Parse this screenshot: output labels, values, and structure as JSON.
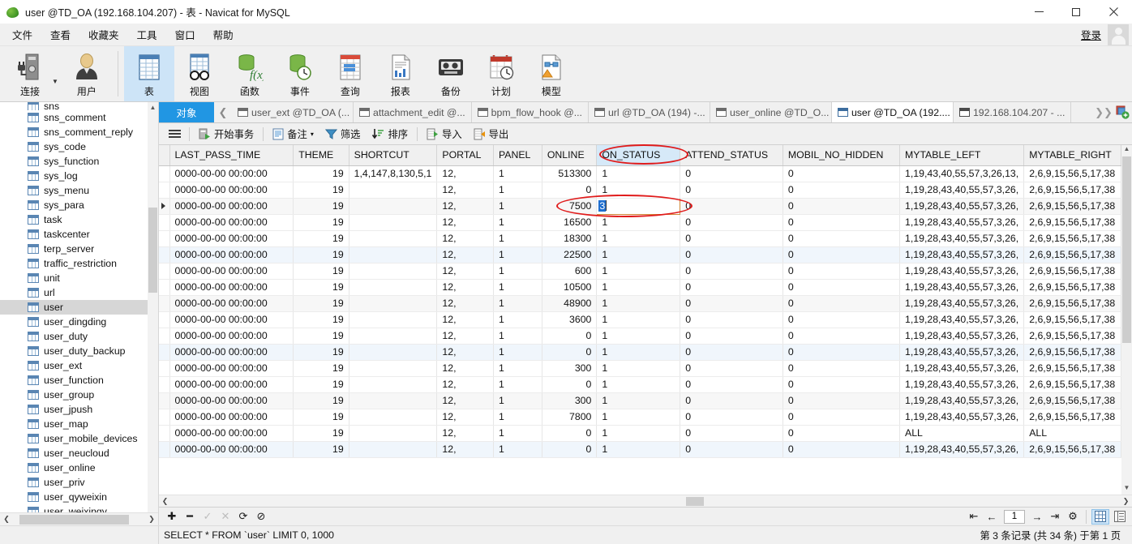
{
  "window": {
    "title": "user @TD_OA (192.168.104.207) - 表 - Navicat for MySQL",
    "minimize": "—",
    "maximize": "□",
    "close": "✕"
  },
  "menu": {
    "items": [
      "文件",
      "查看",
      "收藏夹",
      "工具",
      "窗口",
      "帮助"
    ],
    "login": "登录"
  },
  "ribbon": {
    "left": [
      {
        "label": "连接",
        "icon": "connection-icon"
      },
      {
        "label": "用户",
        "icon": "user-icon"
      }
    ],
    "items": [
      {
        "label": "表",
        "icon": "table-icon",
        "selected": true
      },
      {
        "label": "视图",
        "icon": "view-icon",
        "selected": false
      },
      {
        "label": "函数",
        "icon": "function-icon",
        "selected": false
      },
      {
        "label": "事件",
        "icon": "event-icon",
        "selected": false
      },
      {
        "label": "查询",
        "icon": "query-icon",
        "selected": false
      },
      {
        "label": "报表",
        "icon": "report-icon",
        "selected": false
      },
      {
        "label": "备份",
        "icon": "backup-icon",
        "selected": false
      },
      {
        "label": "计划",
        "icon": "schedule-icon",
        "selected": false
      },
      {
        "label": "模型",
        "icon": "model-icon",
        "selected": false
      }
    ]
  },
  "sidebar": {
    "items": [
      {
        "label": "sns",
        "selected": false,
        "partial": true
      },
      {
        "label": "sns_comment",
        "selected": false
      },
      {
        "label": "sns_comment_reply",
        "selected": false
      },
      {
        "label": "sys_code",
        "selected": false
      },
      {
        "label": "sys_function",
        "selected": false
      },
      {
        "label": "sys_log",
        "selected": false
      },
      {
        "label": "sys_menu",
        "selected": false
      },
      {
        "label": "sys_para",
        "selected": false
      },
      {
        "label": "task",
        "selected": false
      },
      {
        "label": "taskcenter",
        "selected": false
      },
      {
        "label": "terp_server",
        "selected": false
      },
      {
        "label": "traffic_restriction",
        "selected": false
      },
      {
        "label": "unit",
        "selected": false
      },
      {
        "label": "url",
        "selected": false
      },
      {
        "label": "user",
        "selected": true
      },
      {
        "label": "user_dingding",
        "selected": false
      },
      {
        "label": "user_duty",
        "selected": false
      },
      {
        "label": "user_duty_backup",
        "selected": false
      },
      {
        "label": "user_ext",
        "selected": false
      },
      {
        "label": "user_function",
        "selected": false
      },
      {
        "label": "user_group",
        "selected": false
      },
      {
        "label": "user_jpush",
        "selected": false
      },
      {
        "label": "user_map",
        "selected": false
      },
      {
        "label": "user_mobile_devices",
        "selected": false
      },
      {
        "label": "user_neucloud",
        "selected": false
      },
      {
        "label": "user_online",
        "selected": false
      },
      {
        "label": "user_priv",
        "selected": false
      },
      {
        "label": "user_qyweixin",
        "selected": false
      },
      {
        "label": "user_weixinqy",
        "selected": false
      }
    ]
  },
  "tabstrip": {
    "object_tab": "对象",
    "nav_prev": "❮",
    "nav_more": "❯❯",
    "tabs": [
      {
        "label": "user_ext @TD_OA (...",
        "active": false,
        "type": "table"
      },
      {
        "label": "attachment_edit @...",
        "active": false,
        "type": "table"
      },
      {
        "label": "bpm_flow_hook @...",
        "active": false,
        "type": "table"
      },
      {
        "label": "url @TD_OA (194) -...",
        "active": false,
        "type": "table"
      },
      {
        "label": "user_online @TD_O...",
        "active": false,
        "type": "table"
      },
      {
        "label": "user @TD_OA (192....",
        "active": true,
        "type": "table"
      },
      {
        "label": "192.168.104.207 - ...",
        "active": false,
        "type": "console"
      }
    ]
  },
  "actionbar": {
    "items": [
      {
        "label": "开始事务",
        "icon": "transaction-icon"
      },
      {
        "label": "备注",
        "icon": "note-icon",
        "caret": "▾"
      },
      {
        "label": "筛选",
        "icon": "filter-icon"
      },
      {
        "label": "排序",
        "icon": "sort-icon"
      },
      {
        "label": "导入",
        "icon": "import-icon"
      },
      {
        "label": "导出",
        "icon": "export-icon"
      }
    ]
  },
  "grid": {
    "columns": [
      {
        "name": "LAST_PASS_TIME",
        "width": 160,
        "align": "left",
        "highlight": false
      },
      {
        "name": "THEME",
        "width": 72,
        "align": "right",
        "highlight": false
      },
      {
        "name": "SHORTCUT",
        "width": 78,
        "align": "left",
        "highlight": false
      },
      {
        "name": "PORTAL",
        "width": 72,
        "align": "left",
        "highlight": false
      },
      {
        "name": "PANEL",
        "width": 62,
        "align": "left",
        "highlight": false
      },
      {
        "name": "ONLINE",
        "width": 70,
        "align": "right",
        "highlight": false
      },
      {
        "name": "ON_STATUS",
        "width": 108,
        "align": "left",
        "highlight": true
      },
      {
        "name": "ATTEND_STATUS",
        "width": 130,
        "align": "left",
        "highlight": false
      },
      {
        "name": "MOBIL_NO_HIDDEN",
        "width": 148,
        "align": "left",
        "highlight": false
      },
      {
        "name": "MYTABLE_LEFT",
        "width": 150,
        "align": "left",
        "highlight": false
      },
      {
        "name": "MYTABLE_RIGHT",
        "width": 120,
        "align": "left",
        "highlight": false
      }
    ],
    "rows": [
      {
        "current": false,
        "shade": "a",
        "cells": [
          "0000-00-00 00:00:00",
          "19",
          "1,4,147,8,130,5,1",
          "12,",
          "1",
          "513300",
          "1",
          "0",
          "0",
          "1,19,43,40,55,57,3,26,13,",
          "2,6,9,15,56,5,17,38"
        ]
      },
      {
        "current": false,
        "shade": "a",
        "cells": [
          "0000-00-00 00:00:00",
          "19",
          "",
          "12,",
          "1",
          "0",
          "1",
          "0",
          "0",
          "1,19,28,43,40,55,57,3,26,",
          "2,6,9,15,56,5,17,38"
        ]
      },
      {
        "current": true,
        "shade": "b",
        "cells": [
          "0000-00-00 00:00:00",
          "19",
          "",
          "12,",
          "1",
          "7500",
          "3",
          "0",
          "0",
          "1,19,28,43,40,55,57,3,26,",
          "2,6,9,15,56,5,17,38"
        ]
      },
      {
        "current": false,
        "shade": "a",
        "cells": [
          "0000-00-00 00:00:00",
          "19",
          "",
          "12,",
          "1",
          "16500",
          "1",
          "0",
          "0",
          "1,19,28,43,40,55,57,3,26,",
          "2,6,9,15,56,5,17,38"
        ]
      },
      {
        "current": false,
        "shade": "a",
        "cells": [
          "0000-00-00 00:00:00",
          "19",
          "",
          "12,",
          "1",
          "18300",
          "1",
          "0",
          "0",
          "1,19,28,43,40,55,57,3,26,",
          "2,6,9,15,56,5,17,38"
        ]
      },
      {
        "current": false,
        "shade": "c",
        "cells": [
          "0000-00-00 00:00:00",
          "19",
          "",
          "12,",
          "1",
          "22500",
          "1",
          "0",
          "0",
          "1,19,28,43,40,55,57,3,26,",
          "2,6,9,15,56,5,17,38"
        ]
      },
      {
        "current": false,
        "shade": "a",
        "cells": [
          "0000-00-00 00:00:00",
          "19",
          "",
          "12,",
          "1",
          "600",
          "1",
          "0",
          "0",
          "1,19,28,43,40,55,57,3,26,",
          "2,6,9,15,56,5,17,38"
        ]
      },
      {
        "current": false,
        "shade": "a",
        "cells": [
          "0000-00-00 00:00:00",
          "19",
          "",
          "12,",
          "1",
          "10500",
          "1",
          "0",
          "0",
          "1,19,28,43,40,55,57,3,26,",
          "2,6,9,15,56,5,17,38"
        ]
      },
      {
        "current": false,
        "shade": "b",
        "cells": [
          "0000-00-00 00:00:00",
          "19",
          "",
          "12,",
          "1",
          "48900",
          "1",
          "0",
          "0",
          "1,19,28,43,40,55,57,3,26,",
          "2,6,9,15,56,5,17,38"
        ]
      },
      {
        "current": false,
        "shade": "a",
        "cells": [
          "0000-00-00 00:00:00",
          "19",
          "",
          "12,",
          "1",
          "3600",
          "1",
          "0",
          "0",
          "1,19,28,43,40,55,57,3,26,",
          "2,6,9,15,56,5,17,38"
        ]
      },
      {
        "current": false,
        "shade": "a",
        "cells": [
          "0000-00-00 00:00:00",
          "19",
          "",
          "12,",
          "1",
          "0",
          "1",
          "0",
          "0",
          "1,19,28,43,40,55,57,3,26,",
          "2,6,9,15,56,5,17,38"
        ]
      },
      {
        "current": false,
        "shade": "c",
        "cells": [
          "0000-00-00 00:00:00",
          "19",
          "",
          "12,",
          "1",
          "0",
          "1",
          "0",
          "0",
          "1,19,28,43,40,55,57,3,26,",
          "2,6,9,15,56,5,17,38"
        ]
      },
      {
        "current": false,
        "shade": "a",
        "cells": [
          "0000-00-00 00:00:00",
          "19",
          "",
          "12,",
          "1",
          "300",
          "1",
          "0",
          "0",
          "1,19,28,43,40,55,57,3,26,",
          "2,6,9,15,56,5,17,38"
        ]
      },
      {
        "current": false,
        "shade": "a",
        "cells": [
          "0000-00-00 00:00:00",
          "19",
          "",
          "12,",
          "1",
          "0",
          "1",
          "0",
          "0",
          "1,19,28,43,40,55,57,3,26,",
          "2,6,9,15,56,5,17,38"
        ]
      },
      {
        "current": false,
        "shade": "b",
        "cells": [
          "0000-00-00 00:00:00",
          "19",
          "",
          "12,",
          "1",
          "300",
          "1",
          "0",
          "0",
          "1,19,28,43,40,55,57,3,26,",
          "2,6,9,15,56,5,17,38"
        ]
      },
      {
        "current": false,
        "shade": "a",
        "cells": [
          "0000-00-00 00:00:00",
          "19",
          "",
          "12,",
          "1",
          "7800",
          "1",
          "0",
          "0",
          "1,19,28,43,40,55,57,3,26,",
          "2,6,9,15,56,5,17,38"
        ]
      },
      {
        "current": false,
        "shade": "a",
        "cells": [
          "0000-00-00 00:00:00",
          "19",
          "",
          "12,",
          "1",
          "0",
          "1",
          "0",
          "0",
          "ALL",
          "ALL"
        ]
      },
      {
        "current": false,
        "shade": "c",
        "cells": [
          "0000-00-00 00:00:00",
          "19",
          "",
          "12,",
          "1",
          "0",
          "1",
          "0",
          "0",
          "1,19,28,43,40,55,57,3,26,",
          "2,6,9,15,56,5,17,38"
        ]
      }
    ],
    "editing": {
      "row_index": 2,
      "column_index": 6,
      "value": "3"
    }
  },
  "bottombar": {
    "buttons": [
      {
        "icon": "plus-icon",
        "glyph": "✚",
        "disabled": false
      },
      {
        "icon": "minus-icon",
        "glyph": "━",
        "disabled": false
      },
      {
        "icon": "check-icon",
        "glyph": "✓",
        "disabled": true
      },
      {
        "icon": "cross-icon",
        "glyph": "✕",
        "disabled": true
      },
      {
        "icon": "refresh-icon",
        "glyph": "⟳",
        "disabled": false
      },
      {
        "icon": "stop-icon",
        "glyph": "⊘",
        "disabled": false
      }
    ],
    "pager": {
      "first": "⇤",
      "prev": "←",
      "page": "1",
      "next": "→",
      "last": "⇥",
      "settings": "⚙"
    },
    "views": [
      {
        "icon": "grid-view-icon",
        "selected": true
      },
      {
        "icon": "form-view-icon",
        "selected": false
      }
    ]
  },
  "statusbar": {
    "sql": "SELECT * FROM `user` LIMIT 0, 1000",
    "record_info": "第 3 条记录 (共 34 条) 于第 1 页"
  },
  "colors": {
    "accent": "#2196e3",
    "annotation": "#e01b1b",
    "selection": "#1f6fd0",
    "header_highlight": "#d6e9f8"
  }
}
